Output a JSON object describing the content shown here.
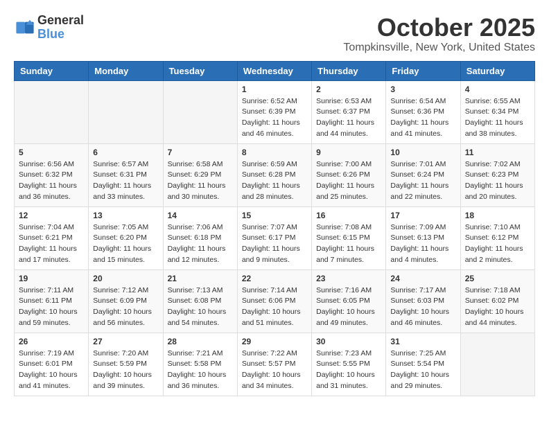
{
  "header": {
    "logo_general": "General",
    "logo_blue": "Blue",
    "month": "October 2025",
    "location": "Tompkinsville, New York, United States"
  },
  "days_of_week": [
    "Sunday",
    "Monday",
    "Tuesday",
    "Wednesday",
    "Thursday",
    "Friday",
    "Saturday"
  ],
  "weeks": [
    [
      {
        "day": "",
        "info": ""
      },
      {
        "day": "",
        "info": ""
      },
      {
        "day": "",
        "info": ""
      },
      {
        "day": "1",
        "info": "Sunrise: 6:52 AM\nSunset: 6:39 PM\nDaylight: 11 hours and 46 minutes."
      },
      {
        "day": "2",
        "info": "Sunrise: 6:53 AM\nSunset: 6:37 PM\nDaylight: 11 hours and 44 minutes."
      },
      {
        "day": "3",
        "info": "Sunrise: 6:54 AM\nSunset: 6:36 PM\nDaylight: 11 hours and 41 minutes."
      },
      {
        "day": "4",
        "info": "Sunrise: 6:55 AM\nSunset: 6:34 PM\nDaylight: 11 hours and 38 minutes."
      }
    ],
    [
      {
        "day": "5",
        "info": "Sunrise: 6:56 AM\nSunset: 6:32 PM\nDaylight: 11 hours and 36 minutes."
      },
      {
        "day": "6",
        "info": "Sunrise: 6:57 AM\nSunset: 6:31 PM\nDaylight: 11 hours and 33 minutes."
      },
      {
        "day": "7",
        "info": "Sunrise: 6:58 AM\nSunset: 6:29 PM\nDaylight: 11 hours and 30 minutes."
      },
      {
        "day": "8",
        "info": "Sunrise: 6:59 AM\nSunset: 6:28 PM\nDaylight: 11 hours and 28 minutes."
      },
      {
        "day": "9",
        "info": "Sunrise: 7:00 AM\nSunset: 6:26 PM\nDaylight: 11 hours and 25 minutes."
      },
      {
        "day": "10",
        "info": "Sunrise: 7:01 AM\nSunset: 6:24 PM\nDaylight: 11 hours and 22 minutes."
      },
      {
        "day": "11",
        "info": "Sunrise: 7:02 AM\nSunset: 6:23 PM\nDaylight: 11 hours and 20 minutes."
      }
    ],
    [
      {
        "day": "12",
        "info": "Sunrise: 7:04 AM\nSunset: 6:21 PM\nDaylight: 11 hours and 17 minutes."
      },
      {
        "day": "13",
        "info": "Sunrise: 7:05 AM\nSunset: 6:20 PM\nDaylight: 11 hours and 15 minutes."
      },
      {
        "day": "14",
        "info": "Sunrise: 7:06 AM\nSunset: 6:18 PM\nDaylight: 11 hours and 12 minutes."
      },
      {
        "day": "15",
        "info": "Sunrise: 7:07 AM\nSunset: 6:17 PM\nDaylight: 11 hours and 9 minutes."
      },
      {
        "day": "16",
        "info": "Sunrise: 7:08 AM\nSunset: 6:15 PM\nDaylight: 11 hours and 7 minutes."
      },
      {
        "day": "17",
        "info": "Sunrise: 7:09 AM\nSunset: 6:13 PM\nDaylight: 11 hours and 4 minutes."
      },
      {
        "day": "18",
        "info": "Sunrise: 7:10 AM\nSunset: 6:12 PM\nDaylight: 11 hours and 2 minutes."
      }
    ],
    [
      {
        "day": "19",
        "info": "Sunrise: 7:11 AM\nSunset: 6:11 PM\nDaylight: 10 hours and 59 minutes."
      },
      {
        "day": "20",
        "info": "Sunrise: 7:12 AM\nSunset: 6:09 PM\nDaylight: 10 hours and 56 minutes."
      },
      {
        "day": "21",
        "info": "Sunrise: 7:13 AM\nSunset: 6:08 PM\nDaylight: 10 hours and 54 minutes."
      },
      {
        "day": "22",
        "info": "Sunrise: 7:14 AM\nSunset: 6:06 PM\nDaylight: 10 hours and 51 minutes."
      },
      {
        "day": "23",
        "info": "Sunrise: 7:16 AM\nSunset: 6:05 PM\nDaylight: 10 hours and 49 minutes."
      },
      {
        "day": "24",
        "info": "Sunrise: 7:17 AM\nSunset: 6:03 PM\nDaylight: 10 hours and 46 minutes."
      },
      {
        "day": "25",
        "info": "Sunrise: 7:18 AM\nSunset: 6:02 PM\nDaylight: 10 hours and 44 minutes."
      }
    ],
    [
      {
        "day": "26",
        "info": "Sunrise: 7:19 AM\nSunset: 6:01 PM\nDaylight: 10 hours and 41 minutes."
      },
      {
        "day": "27",
        "info": "Sunrise: 7:20 AM\nSunset: 5:59 PM\nDaylight: 10 hours and 39 minutes."
      },
      {
        "day": "28",
        "info": "Sunrise: 7:21 AM\nSunset: 5:58 PM\nDaylight: 10 hours and 36 minutes."
      },
      {
        "day": "29",
        "info": "Sunrise: 7:22 AM\nSunset: 5:57 PM\nDaylight: 10 hours and 34 minutes."
      },
      {
        "day": "30",
        "info": "Sunrise: 7:23 AM\nSunset: 5:55 PM\nDaylight: 10 hours and 31 minutes."
      },
      {
        "day": "31",
        "info": "Sunrise: 7:25 AM\nSunset: 5:54 PM\nDaylight: 10 hours and 29 minutes."
      },
      {
        "day": "",
        "info": ""
      }
    ]
  ]
}
